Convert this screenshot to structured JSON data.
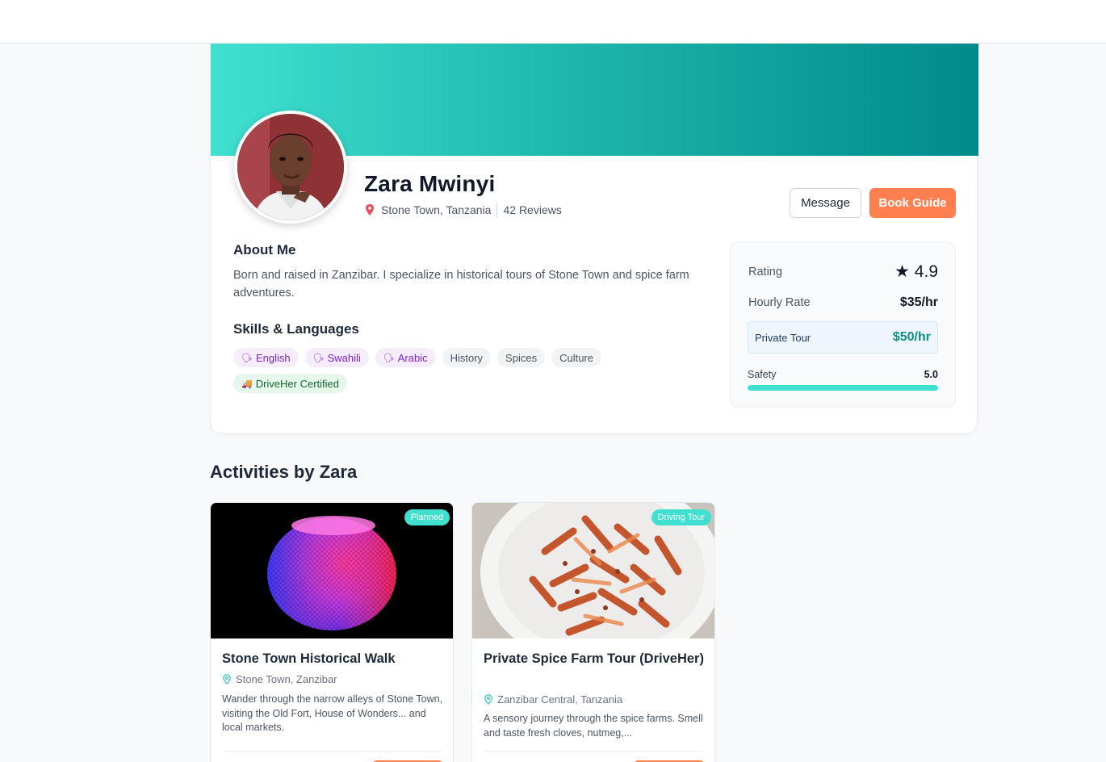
{
  "profile": {
    "name": "Zara Mwinyi",
    "location": "Stone Town, Tanzania",
    "reviews": "42 Reviews",
    "message_label": "Message",
    "book_label": "Book Guide"
  },
  "about": {
    "title": "About Me",
    "text": "Born and raised in Zanzibar. I specialize in historical tours of Stone Town and spice farm adventures."
  },
  "skills": {
    "title": "Skills & Languages",
    "languages": [
      "English",
      "Swahili",
      "Arabic"
    ],
    "items": [
      "History",
      "Spices",
      "Culture"
    ],
    "certification": "DriveHer Certified"
  },
  "stats": {
    "rating_label": "Rating",
    "rating_value": "★ 4.9",
    "hourly_label": "Hourly Rate",
    "hourly_value": "$35/hr",
    "private_label": "Private Tour",
    "private_value": "$50/hr",
    "safety_label": "Safety",
    "safety_value": "5.0",
    "safety_fraction": 1.0
  },
  "activities": {
    "title": "Activities by Zara",
    "cards": [
      {
        "badge": "Planned",
        "title": "Stone Town Historical Walk",
        "location": "Stone Town, Zanzibar",
        "description": "Wander through the narrow alleys of Stone Town, visiting the Old Fort, House of Wonders... and local markets."
      },
      {
        "badge": "Driving Tour",
        "title": "Private Spice Farm Tour (DriveHer)",
        "location": "Zanzibar Central, Tanzania",
        "description": "A sensory journey through the spice farms. Smell and taste fresh cloves, nutmeg,..."
      }
    ]
  },
  "colors": {
    "accent": "#40e0d0",
    "accent_dark": "#008b8b",
    "cta": "#ff7f50",
    "language_tag": "#7e22ce",
    "certified_tag": "#166534"
  }
}
